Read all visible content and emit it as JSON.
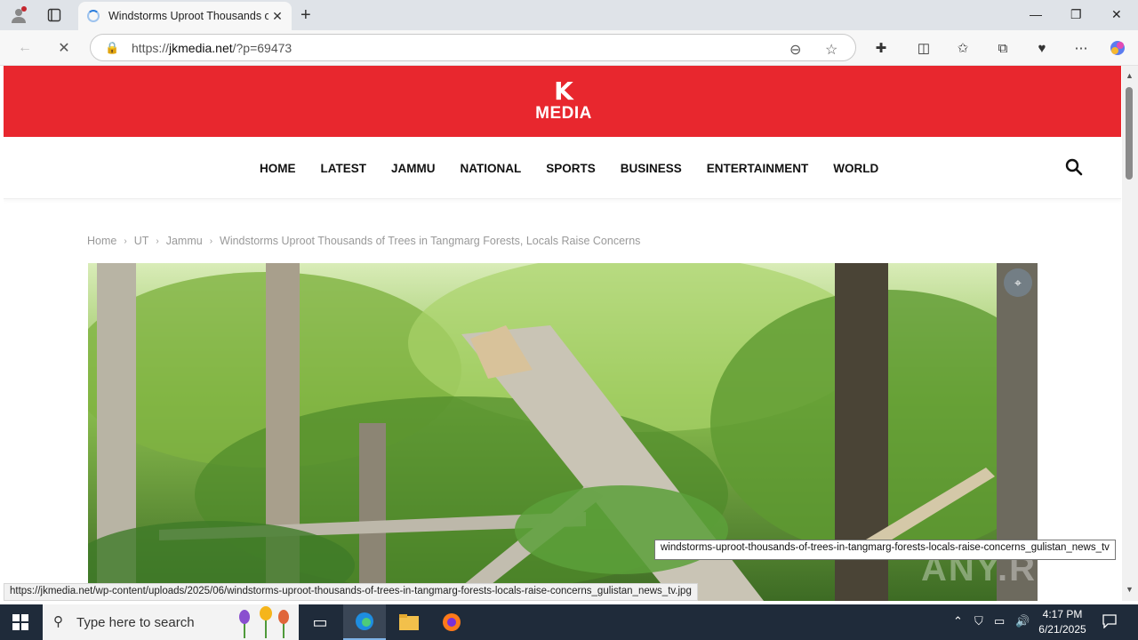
{
  "browser": {
    "tab_title": "Windstorms Uproot Thousands of Trees in Tangmarg Forests, Locals Raise Concerns",
    "url_prefix": "https://",
    "url_host": "jkmedia.net",
    "url_path": "/?p=69473"
  },
  "site": {
    "logo_mark": "K",
    "logo_word": "MEDIA",
    "brand_color": "#e8272e",
    "menu": [
      "HOME",
      "LATEST",
      "JAMMU",
      "NATIONAL",
      "SPORTS",
      "BUSINESS",
      "ENTERTAINMENT",
      "WORLD"
    ]
  },
  "breadcrumb": {
    "items": [
      "Home",
      "UT",
      "Jammu",
      "Windstorms Uproot Thousands of Trees in Tangmarg Forests, Locals Raise Concerns"
    ]
  },
  "hero": {
    "alt": "windstorms-uproot-thousands-of-trees-in-tangmarg-forests-locals-raise-concerns_gulistan_news_tv"
  },
  "tooltip": "windstorms-uproot-thousands-of-trees-in-tangmarg-forests-locals-raise-concerns_gulistan_news_tv",
  "status_url": "https://jkmedia.net/wp-content/uploads/2025/06/windstorms-uproot-thousands-of-trees-in-tangmarg-forests-locals-raise-concerns_gulistan_news_tv.jpg",
  "watermark": "ANY.RUN",
  "taskbar": {
    "search_placeholder": "Type here to search",
    "time": "4:17 PM",
    "date": "6/21/2025"
  }
}
